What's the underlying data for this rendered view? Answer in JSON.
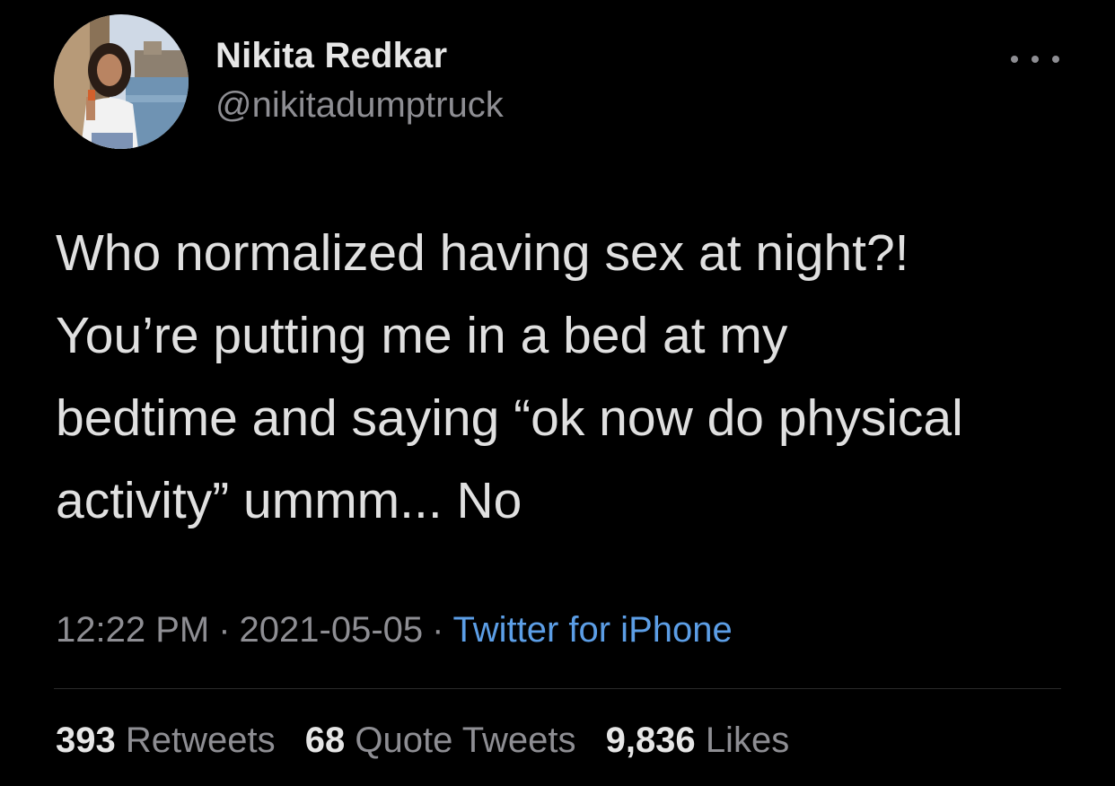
{
  "author": {
    "name": "Nikita Redkar",
    "handle": "@nikitadumptruck"
  },
  "menu_icon": "more-horizontal-icon",
  "tweet": {
    "lines": [
      "Who normalized having sex at night?!",
      "You’re putting me in a bed at my",
      "bedtime and saying “ok now do physical",
      "activity” ummm... No"
    ]
  },
  "meta": {
    "time": "12:22 PM",
    "separator": "·",
    "date": "2021-05-05",
    "source": "Twitter for iPhone"
  },
  "stats": {
    "retweets": {
      "count": "393",
      "label": "Retweets"
    },
    "quote_tweets": {
      "count": "68",
      "label": "Quote Tweets"
    },
    "likes": {
      "count": "9,836",
      "label": "Likes"
    }
  },
  "colors": {
    "background": "#000000",
    "text": "#e0e0e0",
    "muted": "#8e8e93",
    "link": "#5c9ee6"
  }
}
